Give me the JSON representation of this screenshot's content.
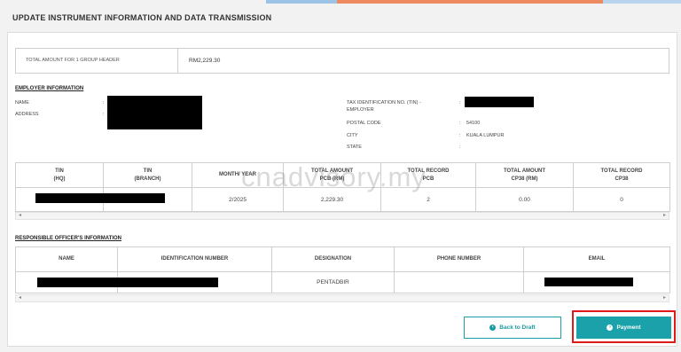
{
  "page": {
    "title": "UPDATE INSTRUMENT INFORMATION AND DATA TRANSMISSION"
  },
  "colors": {
    "accent": "#1aa1a9",
    "highlight": "#e01919",
    "topbar": [
      "#8bb9e0",
      "#f2a15a",
      "#e86c4f"
    ]
  },
  "group_header": {
    "label": "TOTAL AMOUNT FOR 1 GROUP HEADER",
    "value": "RM2,229.30"
  },
  "employer": {
    "heading": "EMPLOYER INFORMATION",
    "left": [
      {
        "label": "NAME",
        "colon": ":"
      },
      {
        "label": "ADDRESS",
        "colon": ":"
      }
    ],
    "right": [
      {
        "label": "TAX IDENTIFICATION NO. (TIN) - EMPLOYER",
        "colon": ":",
        "value": ""
      },
      {
        "label": "POSTAL CODE",
        "colon": ":",
        "value": "54100"
      },
      {
        "label": "CITY",
        "colon": ":",
        "value": "KUALA LUMPUR"
      },
      {
        "label": "STATE",
        "colon": ":",
        "value": ""
      }
    ]
  },
  "summary_table": {
    "headers": [
      [
        "TIN",
        "(HQ)"
      ],
      [
        "TIN",
        "(BRANCH)"
      ],
      [
        "MONTH/ YEAR",
        ""
      ],
      [
        "TOTAL AMOUNT",
        "PCB (RM)"
      ],
      [
        "TOTAL RECORD",
        "PCB"
      ],
      [
        "TOTAL AMOUNT",
        "CP38 (RM)"
      ],
      [
        "TOTAL RECORD",
        "CP38"
      ]
    ],
    "row": [
      "",
      "",
      "2/2025",
      "2,229.30",
      "2",
      "0.00",
      "0"
    ]
  },
  "officer": {
    "heading": "RESPONSIBLE OFFICER'S INFORMATION",
    "headers": [
      "NAME",
      "IDENTIFICATION NUMBER",
      "DESIGNATION",
      "PHONE NUMBER",
      "EMAIL"
    ],
    "row": [
      "",
      "",
      "PENTADBIR",
      "",
      ""
    ]
  },
  "watermark": "cnadvisory.my",
  "scroll": {
    "left": "◂",
    "right": "▸"
  },
  "buttons": {
    "back_to_draft": "Back to Draft",
    "payment": "Payment",
    "back_icon": "back-circle-icon",
    "pay_icon": "payment-circle-icon"
  }
}
